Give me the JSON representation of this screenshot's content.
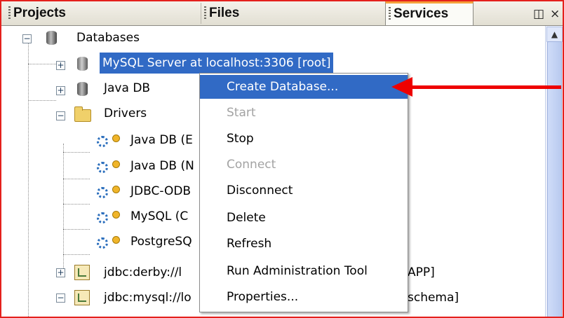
{
  "tabs": [
    {
      "label": "Projects"
    },
    {
      "label": "Files"
    },
    {
      "label": "Services"
    }
  ],
  "tab_controls": {
    "minimize_glyph": "◫",
    "close_glyph": "×"
  },
  "tree": {
    "databases": "Databases",
    "mysql_server": "MySQL Server at localhost:3306 [root]",
    "java_db": "Java DB",
    "drivers": "Drivers",
    "driver_items": [
      "Java DB (E",
      "Java DB (N",
      "JDBC-ODB",
      "MySQL (C",
      "PostgreSQ"
    ],
    "connections": [
      "jdbc:derby://l",
      "jdbc:mysql://lo"
    ],
    "connection_tails": [
      "APP]",
      "schema]"
    ]
  },
  "context_menu": {
    "items": [
      {
        "label": "Create Database...",
        "state": "highlighted"
      },
      {
        "label": "Start",
        "state": "disabled"
      },
      {
        "label": "Stop",
        "state": "enabled"
      },
      {
        "label": "Connect",
        "state": "disabled"
      },
      {
        "label": "Disconnect",
        "state": "enabled"
      },
      {
        "label": "Delete",
        "state": "enabled"
      },
      {
        "label": "Refresh",
        "state": "enabled"
      },
      {
        "label": "Run Administration Tool",
        "state": "enabled"
      },
      {
        "label": "Properties...",
        "state": "enabled"
      }
    ]
  },
  "colors": {
    "selection": "#316ac5",
    "annotation_arrow": "#ee0000",
    "frame_border": "#e4211d"
  }
}
